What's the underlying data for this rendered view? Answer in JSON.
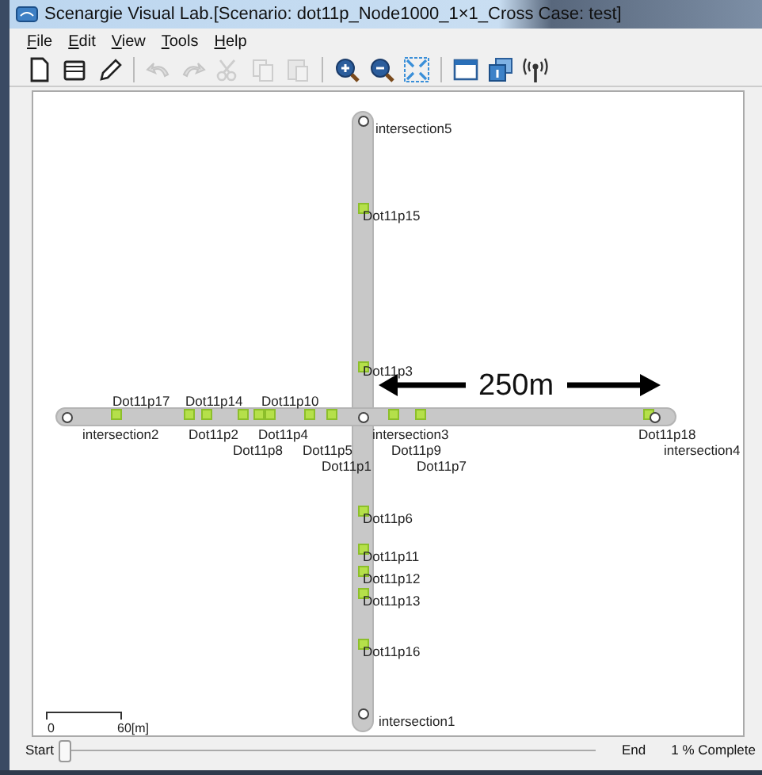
{
  "window": {
    "title": "Scenargie Visual Lab.[Scenario: dot11p_Node1000_1×1_Cross Case: test]"
  },
  "menu": [
    {
      "label": "File"
    },
    {
      "label": "Edit"
    },
    {
      "label": "View"
    },
    {
      "label": "Tools"
    },
    {
      "label": "Help"
    }
  ],
  "toolbar": [
    {
      "disabled": false
    },
    {
      "disabled": false
    },
    {
      "disabled": false
    },
    {
      "disabled": true
    },
    {
      "disabled": true
    },
    {
      "disabled": true
    },
    {
      "disabled": true
    },
    {
      "disabled": true
    },
    {
      "disabled": false
    },
    {
      "disabled": false
    },
    {
      "disabled": false
    },
    {
      "disabled": false
    },
    {
      "disabled": false
    },
    {
      "disabled": false
    }
  ],
  "canvas": {
    "nodes": [
      {
        "kind": "intersection",
        "label": "intersection5"
      },
      {
        "kind": "node",
        "label": "Dot11p15"
      },
      {
        "kind": "node",
        "label": "Dot11p3"
      },
      {
        "kind": "intersection",
        "label": "intersection2"
      },
      {
        "kind": "node",
        "label": "Dot11p17"
      },
      {
        "kind": "node",
        "label": "Dot11p14"
      },
      {
        "kind": "node",
        "label": "Dot11p2"
      },
      {
        "kind": "node",
        "label": "Dot11p8"
      },
      {
        "kind": "node",
        "label": "Dot11p10"
      },
      {
        "kind": "node",
        "label": "Dot11p4"
      },
      {
        "kind": "node",
        "label": "Dot11p5"
      },
      {
        "kind": "node",
        "label": "Dot11p1"
      },
      {
        "kind": "intersection",
        "label": "intersection3"
      },
      {
        "kind": "node",
        "label": "Dot11p9"
      },
      {
        "kind": "node",
        "label": "Dot11p7"
      },
      {
        "kind": "node",
        "label": "Dot11p18"
      },
      {
        "kind": "intersection",
        "label": "intersection4"
      },
      {
        "kind": "node",
        "label": "Dot11p6"
      },
      {
        "kind": "node",
        "label": "Dot11p11"
      },
      {
        "kind": "node",
        "label": "Dot11p12"
      },
      {
        "kind": "node",
        "label": "Dot11p13"
      },
      {
        "kind": "node",
        "label": "Dot11p16"
      },
      {
        "kind": "intersection",
        "label": "intersection1"
      }
    ],
    "distance_label": "250m",
    "scale": {
      "start": "0",
      "end": "60[m]"
    }
  },
  "status_bar": {
    "start": "Start",
    "level": 0.01,
    "end": "End",
    "progress": "1 % Complete"
  }
}
